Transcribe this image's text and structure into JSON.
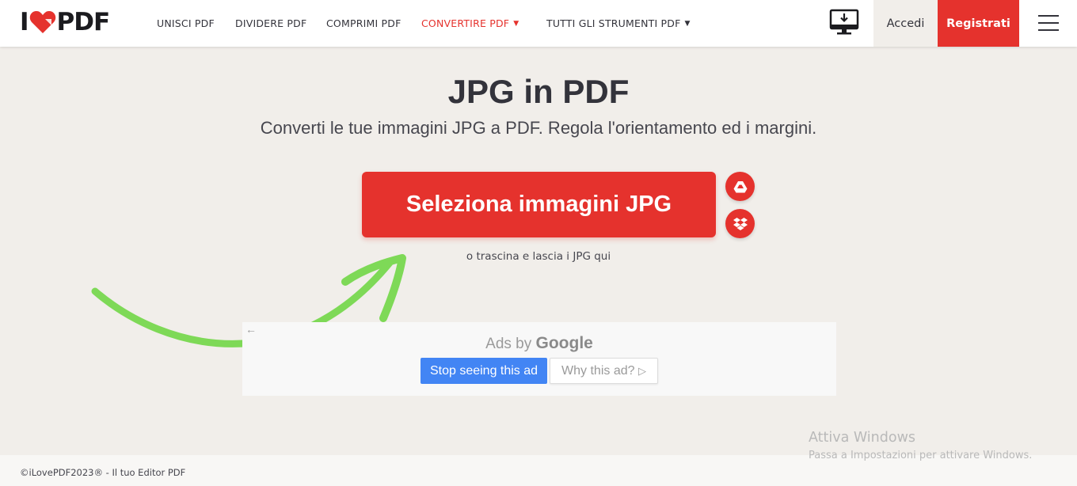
{
  "header": {
    "logo": {
      "left": "I",
      "right": "PDF"
    },
    "nav": [
      {
        "label": "UNISCI PDF"
      },
      {
        "label": "DIVIDERE PDF"
      },
      {
        "label": "COMPRIMI PDF"
      },
      {
        "label": "CONVERTIRE PDF",
        "active": true,
        "dropdown": true
      },
      {
        "label": "TUTTI GLI STRUMENTI PDF",
        "dropdown": true
      }
    ],
    "desktop_icon": "desktop-download-icon",
    "login_label": "Accedi",
    "signup_label": "Registrati",
    "menu_icon": "hamburger-menu-icon"
  },
  "main": {
    "title": "JPG in PDF",
    "subtitle": "Converti le tue immagini JPG a PDF. Regola l'orientamento ed i margini.",
    "select_button": "Seleziona immagini JPG",
    "drop_hint": "o trascina e lascia i JPG qui",
    "cloud_buttons": [
      {
        "icon": "google-drive-icon"
      },
      {
        "icon": "dropbox-icon"
      }
    ]
  },
  "ad": {
    "back_glyph": "←",
    "ads_by": "Ads by",
    "google": "Google",
    "stop_label": "Stop seeing this ad",
    "why_label": "Why this ad?",
    "why_glyph": "▷"
  },
  "footer": {
    "text": "©iLovePDF2023® - Il tuo Editor PDF"
  },
  "watermark": {
    "title": "Attiva Windows",
    "subtitle": "Passa a Impostazioni per attivare Windows."
  },
  "colors": {
    "brand_red": "#e5322d",
    "arrow_green": "#7ed957",
    "google_blue": "#4285f4",
    "background": "#f1eeea"
  }
}
